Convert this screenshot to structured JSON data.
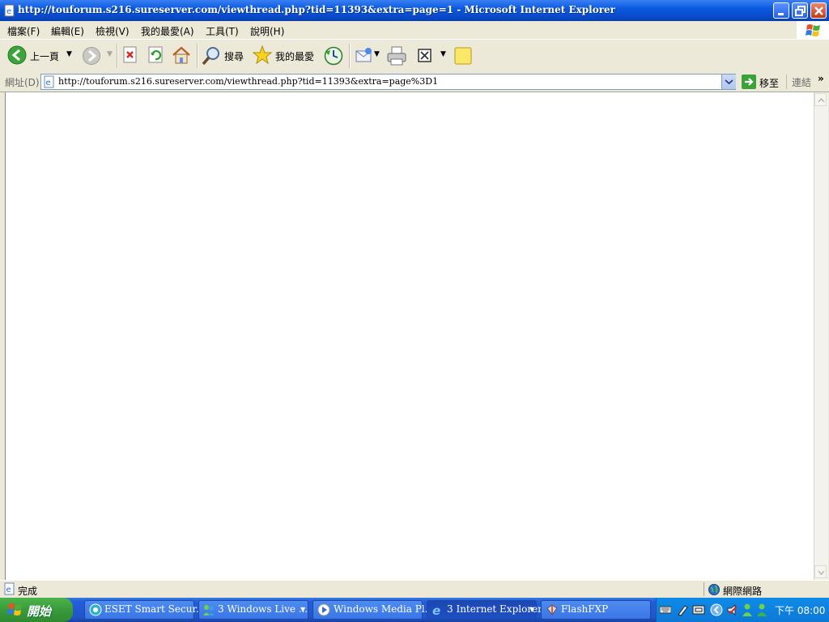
{
  "window": {
    "title": "http://touforum.s216.sureserver.com/viewthread.php?tid=11393&extra=page=1 - Microsoft Internet Explorer"
  },
  "menu": {
    "items": [
      "檔案(F)",
      "編輯(E)",
      "檢視(V)",
      "我的最愛(A)",
      "工具(T)",
      "說明(H)"
    ]
  },
  "toolbar": {
    "back_label": "上一頁",
    "search_label": "搜尋",
    "favorites_label": "我的最愛"
  },
  "address": {
    "label": "網址(D)",
    "url": "http://touforum.s216.sureserver.com/viewthread.php?tid=11393&extra=page%3D1",
    "go_label": "移至",
    "links_label": "連結"
  },
  "status": {
    "text": "完成",
    "zone": "網際網路"
  },
  "taskbar": {
    "start_label": "開始",
    "tasks": [
      "ESET Smart Secur...",
      "3  Windows Live ...",
      "Windows Media Pl...",
      "3  Internet Explorer",
      "FlashFXP"
    ],
    "clock": "下午 08:00"
  },
  "colors": {
    "titlebar": "#0a5ae0",
    "taskbar": "#245edb",
    "start_button": "#3a9a3a",
    "face": "#ece9d8"
  }
}
